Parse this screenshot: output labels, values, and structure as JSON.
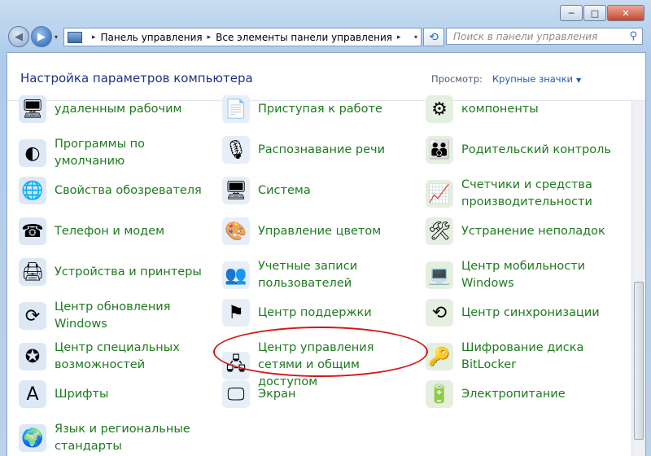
{
  "window": {
    "minimize": "─",
    "maximize": "□",
    "close": "✕"
  },
  "nav": {
    "back": "◀",
    "forward": "▶",
    "history": "▾"
  },
  "address": {
    "crumbs": [
      "Панель управления",
      "Все элементы панели управления"
    ],
    "arrow": "▸",
    "drop": "▾"
  },
  "refresh": "⟲",
  "search": {
    "placeholder": "Поиск в панели управления",
    "icon": "⚲"
  },
  "header": {
    "title": "Настройка параметров компьютера",
    "viewby_label": "Просмотр:",
    "viewby_value": "Крупные значки",
    "viewby_arrow": "▼"
  },
  "items": [
    {
      "label": "удаленным рабочим",
      "icon": "remote-desktop-icon",
      "glyph": "🖥"
    },
    {
      "label": "Приступая к работе",
      "icon": "getting-started-icon",
      "glyph": "📄"
    },
    {
      "label": "компоненты",
      "icon": "programs-components-icon",
      "glyph": "⚙"
    },
    {
      "label": "Программы по умолчанию",
      "icon": "default-programs-icon",
      "glyph": "◐"
    },
    {
      "label": "Распознавание речи",
      "icon": "speech-recognition-icon",
      "glyph": "🎙"
    },
    {
      "label": "Родительский контроль",
      "icon": "parental-controls-icon",
      "glyph": "👪"
    },
    {
      "label": "Свойства обозревателя",
      "icon": "internet-options-icon",
      "glyph": "🌐"
    },
    {
      "label": "Система",
      "icon": "system-icon",
      "glyph": "🖥"
    },
    {
      "label": "Счетчики и средства производительности",
      "icon": "performance-icon",
      "glyph": "📈"
    },
    {
      "label": "Телефон и модем",
      "icon": "phone-modem-icon",
      "glyph": "☎"
    },
    {
      "label": "Управление цветом",
      "icon": "color-management-icon",
      "glyph": "🎨"
    },
    {
      "label": "Устранение неполадок",
      "icon": "troubleshooting-icon",
      "glyph": "🛠"
    },
    {
      "label": "Устройства и принтеры",
      "icon": "devices-printers-icon",
      "glyph": "🖨"
    },
    {
      "label": "Учетные записи пользователей",
      "icon": "user-accounts-icon",
      "glyph": "👥"
    },
    {
      "label": "Центр мобильности Windows",
      "icon": "mobility-center-icon",
      "glyph": "💻"
    },
    {
      "label": "Центр обновления Windows",
      "icon": "windows-update-icon",
      "glyph": "⟳"
    },
    {
      "label": "Центр поддержки",
      "icon": "action-center-icon",
      "glyph": "⚑"
    },
    {
      "label": "Центр синхронизации",
      "icon": "sync-center-icon",
      "glyph": "⟲"
    },
    {
      "label": "Центр специальных возможностей",
      "icon": "ease-of-access-icon",
      "glyph": "✪"
    },
    {
      "label": "Центр управления сетями и общим доступом",
      "icon": "network-sharing-icon",
      "glyph": "🖧"
    },
    {
      "label": "Шифрование диска BitLocker",
      "icon": "bitlocker-icon",
      "glyph": "🔑"
    },
    {
      "label": "Шрифты",
      "icon": "fonts-icon",
      "glyph": "A"
    },
    {
      "label": "Экран",
      "icon": "display-icon",
      "glyph": "🖵"
    },
    {
      "label": "Электропитание",
      "icon": "power-options-icon",
      "glyph": "🔋"
    },
    {
      "label": "Язык и региональные стандарты",
      "icon": "region-language-icon",
      "glyph": "🌍"
    }
  ],
  "colors": {
    "link_green": "#1e7a1e",
    "header_blue": "#1e3287",
    "annotation_red": "#d01818"
  }
}
